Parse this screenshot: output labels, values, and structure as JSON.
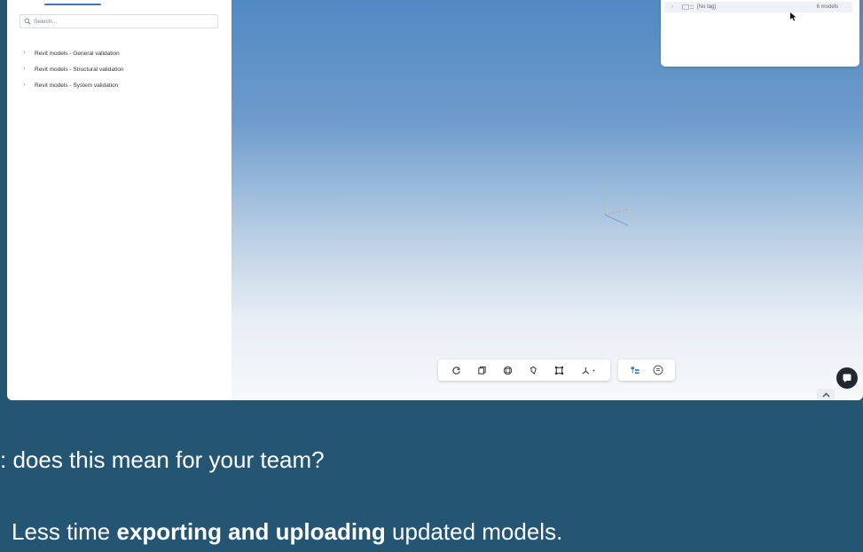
{
  "search": {
    "placeholder": "Search..."
  },
  "tree": {
    "items": [
      {
        "label": "Revit models - General validation"
      },
      {
        "label": "Revit models - Structural validation"
      },
      {
        "label": "Revit models - System validation"
      }
    ]
  },
  "tag_popup": {
    "tag_name": "[No tag]",
    "count": "6 models"
  },
  "toolbar": {
    "icons": [
      "rotate-icon",
      "cube-view-icon",
      "section-icon",
      "orbit-icon",
      "fit-frame-icon",
      "axes-dropdown-icon"
    ],
    "icons_right": [
      "model-tree-icon",
      "properties-icon"
    ]
  },
  "caption": {
    "line1": ": does this mean for your team?",
    "line2_prefix": "Less time ",
    "line2_bold": "exporting and uploading",
    "line2_suffix": " updated models."
  },
  "colors": {
    "background": "#245572",
    "accent": "#3a79c4",
    "viewport_top": "#5189c2",
    "viewport_bottom": "#f6f8fb"
  }
}
